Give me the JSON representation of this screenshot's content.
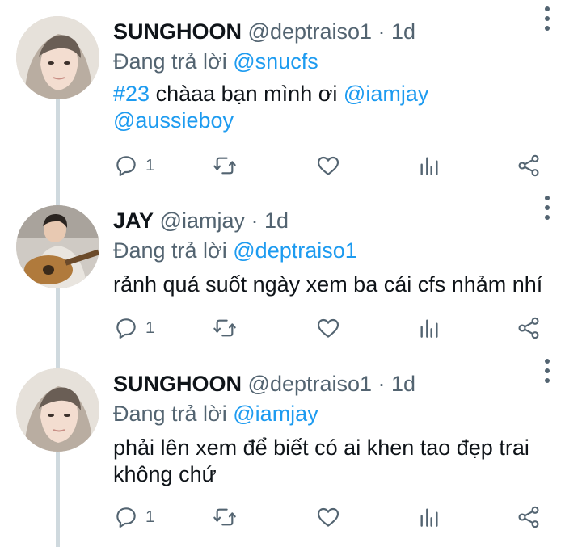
{
  "tweets": [
    {
      "name": "SUNGHOON",
      "handle": "@deptraiso1",
      "sep": " · ",
      "time": "1d",
      "replying_prefix": "Đang trả lời ",
      "replying_to": "@snucfs",
      "content": {
        "hashtag": "#23",
        "text": " chàaa bạn mình ơi ",
        "mention1": "@iamjay",
        "mention2": "@aussieboy"
      },
      "reply_count": "1",
      "avatar_icon": "person-hoodie-avatar"
    },
    {
      "name": "JAY",
      "handle": "@iamjay",
      "sep": " · ",
      "time": "1d",
      "replying_prefix": "Đang trả lời ",
      "replying_to": "@deptraiso1",
      "content": {
        "text": "rảnh quá suốt ngày xem ba cái cfs nhảm nhí"
      },
      "reply_count": "1",
      "avatar_icon": "person-guitar-avatar"
    },
    {
      "name": "SUNGHOON",
      "handle": "@deptraiso1",
      "sep": " · ",
      "time": "1d",
      "replying_prefix": "Đang trả lời ",
      "replying_to": "@iamjay",
      "content": {
        "line1": "phải lên xem để biết có ai khen tao đẹp trai",
        "line2": "không chứ"
      },
      "reply_count": "1",
      "avatar_icon": "person-hoodie-avatar"
    }
  ],
  "colors": {
    "accent": "#1d9bf0",
    "muted": "#536471",
    "text": "#0f1419",
    "thread": "#cfd9de"
  },
  "icons": [
    "reply-icon",
    "retweet-icon",
    "like-icon",
    "analytics-icon",
    "share-icon",
    "more-icon"
  ]
}
